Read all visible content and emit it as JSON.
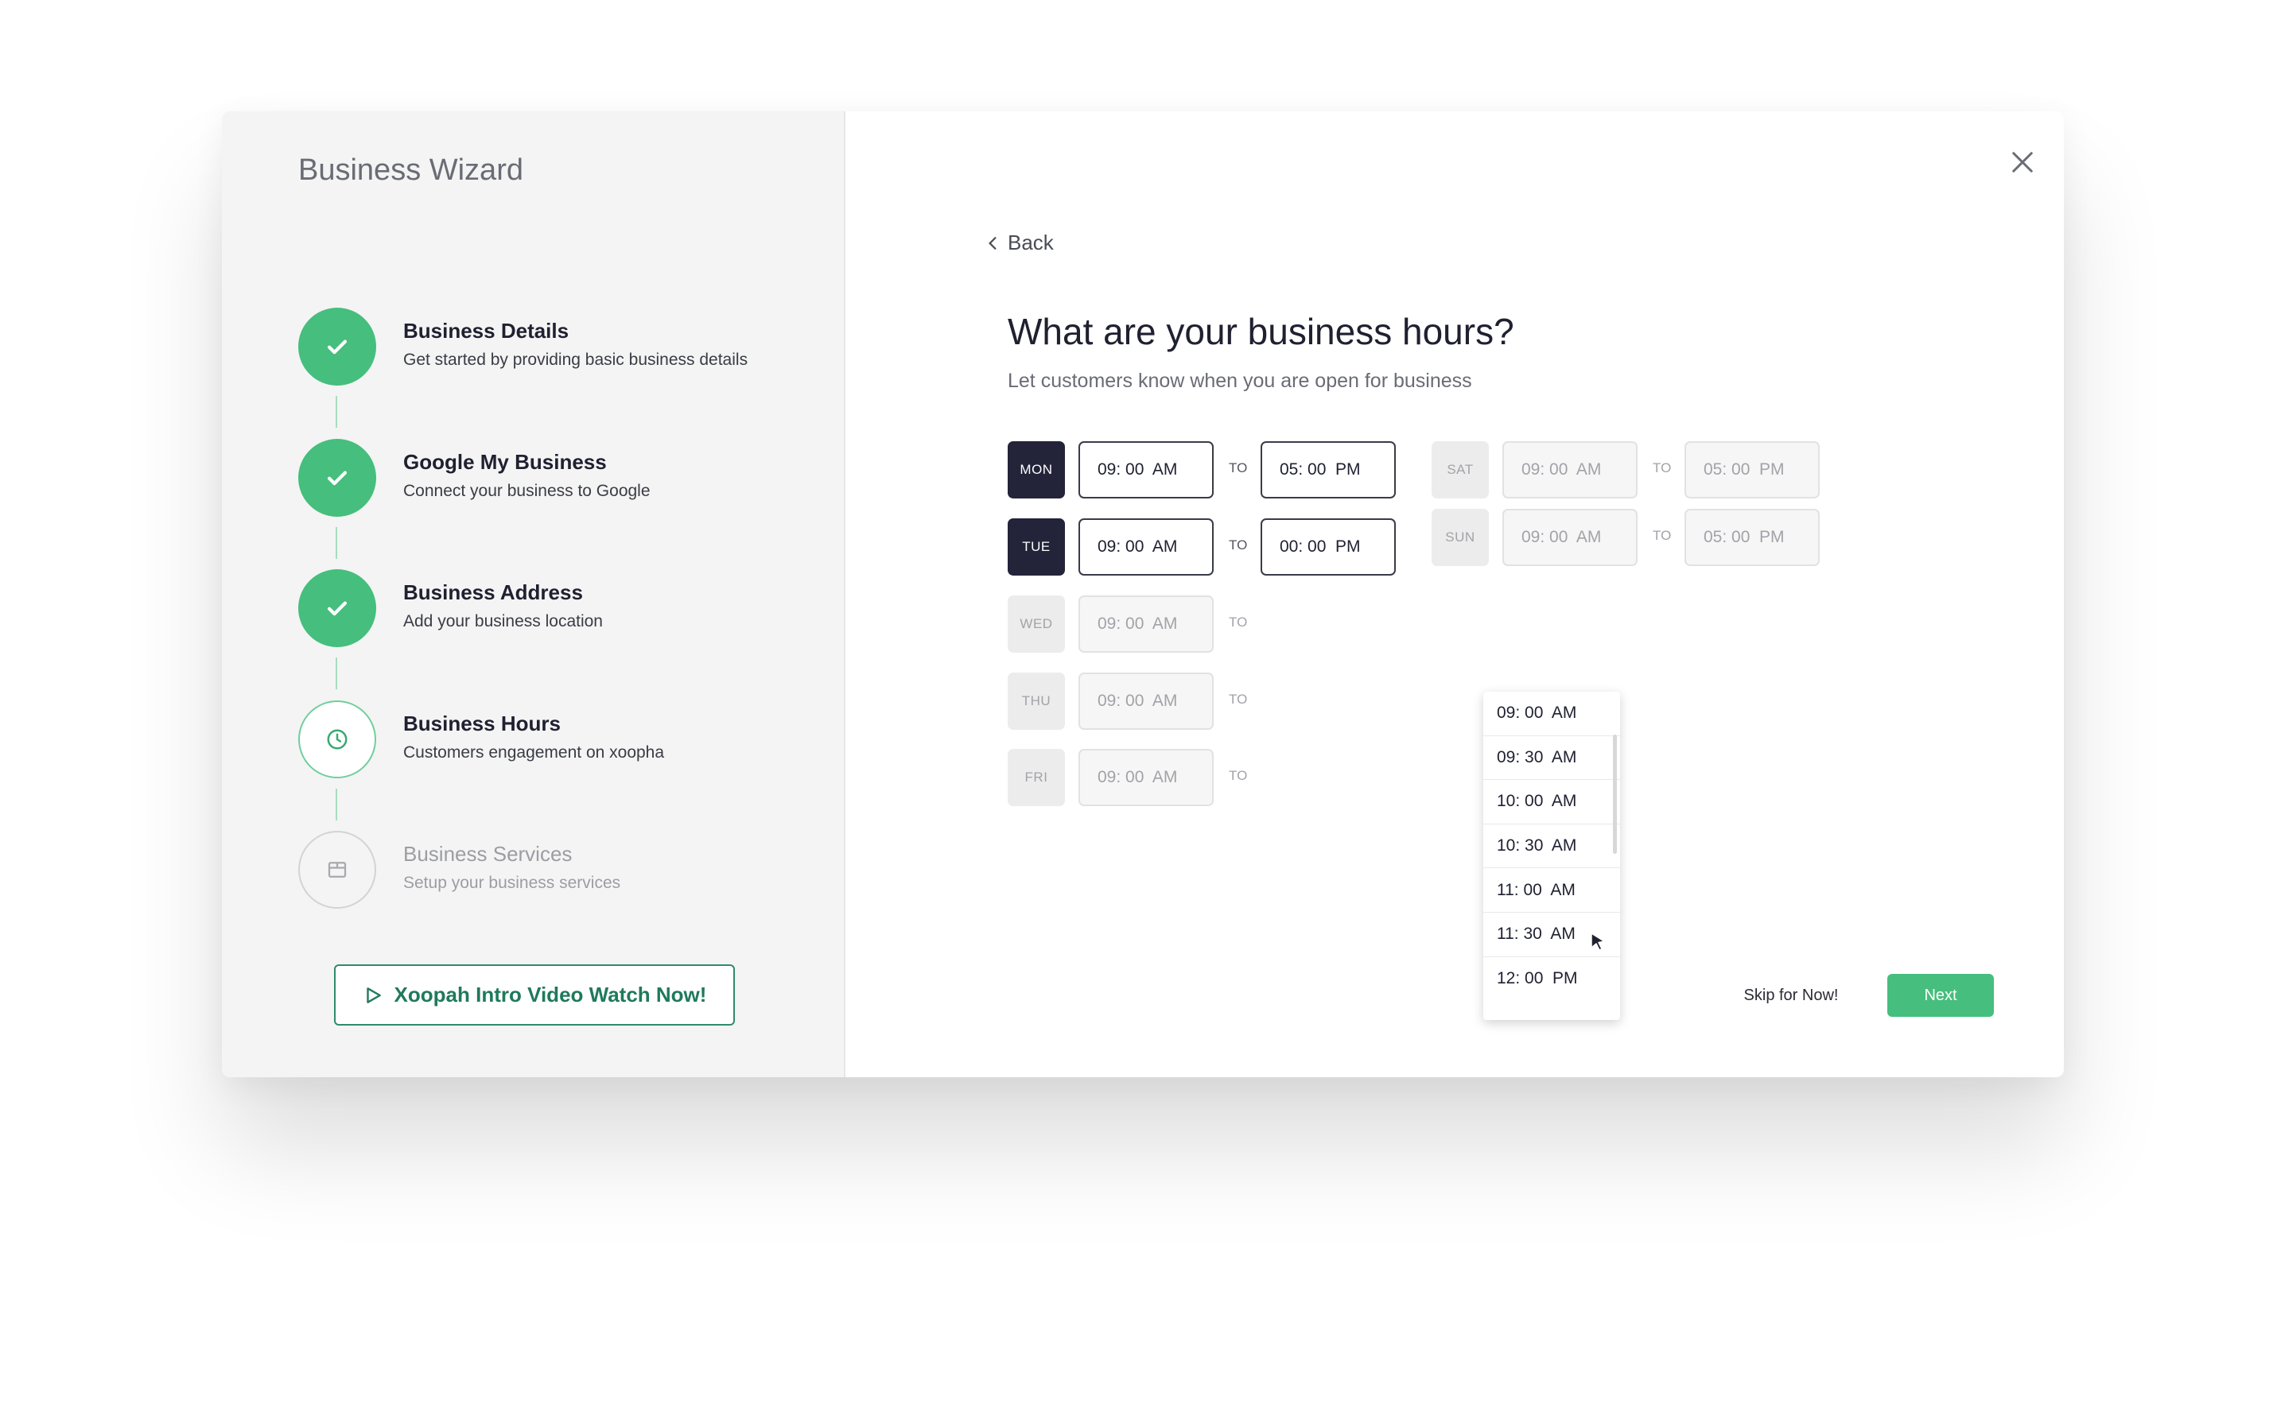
{
  "wizard": {
    "title": "Business Wizard"
  },
  "steps": [
    {
      "title": "Business Details",
      "subtitle": "Get started by providing basic business details",
      "status": "done",
      "icon": "check-icon"
    },
    {
      "title": "Google My Business",
      "subtitle": "Connect your business to Google",
      "status": "done",
      "icon": "check-icon"
    },
    {
      "title": "Business Address",
      "subtitle": "Add your business location",
      "status": "done",
      "icon": "check-icon"
    },
    {
      "title": "Business Hours",
      "subtitle": "Customers engagement on xoopha",
      "status": "active",
      "icon": "clock-icon"
    },
    {
      "title": "Business Services",
      "subtitle": "Setup your business services",
      "status": "pending",
      "icon": "box-icon"
    }
  ],
  "intro_video": {
    "label": "Xoopah Intro Video Watch Now!",
    "icon": "play-icon"
  },
  "close": {
    "icon": "close-icon"
  },
  "back": {
    "label": "Back",
    "icon": "chevron-left-icon"
  },
  "main": {
    "heading": "What are your business hours?",
    "subheading": "Let customers know when you are open for business"
  },
  "hours": [
    {
      "day": "MON",
      "from": "09: 00  AM",
      "to_label": "TO",
      "to": "05: 00  PM",
      "enabled": true
    },
    {
      "day": "TUE",
      "from": "09: 00  AM",
      "to_label": "TO",
      "to": "00: 00  PM",
      "enabled": true
    },
    {
      "day": "WED",
      "from": "09: 00  AM",
      "to_label": "TO",
      "to": "",
      "enabled": false
    },
    {
      "day": "THU",
      "from": "09: 00  AM",
      "to_label": "TO",
      "to": "",
      "enabled": false
    },
    {
      "day": "FRI",
      "from": "09: 00  AM",
      "to_label": "TO",
      "to": "",
      "enabled": false
    },
    {
      "day": "SAT",
      "from": "09: 00  AM",
      "to_label": "TO",
      "to": "05: 00  PM",
      "enabled": false
    },
    {
      "day": "SUN",
      "from": "09: 00  AM",
      "to_label": "TO",
      "to": "05: 00  PM",
      "enabled": false
    }
  ],
  "time_dropdown": {
    "options": [
      "09: 00  AM",
      "09: 30  AM",
      "10: 00  AM",
      "10: 30  AM",
      "11: 00  AM",
      "11: 30  AM",
      "12: 00  PM"
    ]
  },
  "actions": {
    "skip_label": "Skip for Now!",
    "next_label": "Next"
  },
  "colors": {
    "accent": "#46be7d",
    "dark_chip": "#23233a",
    "sidebar_bg": "#f4f4f4"
  }
}
